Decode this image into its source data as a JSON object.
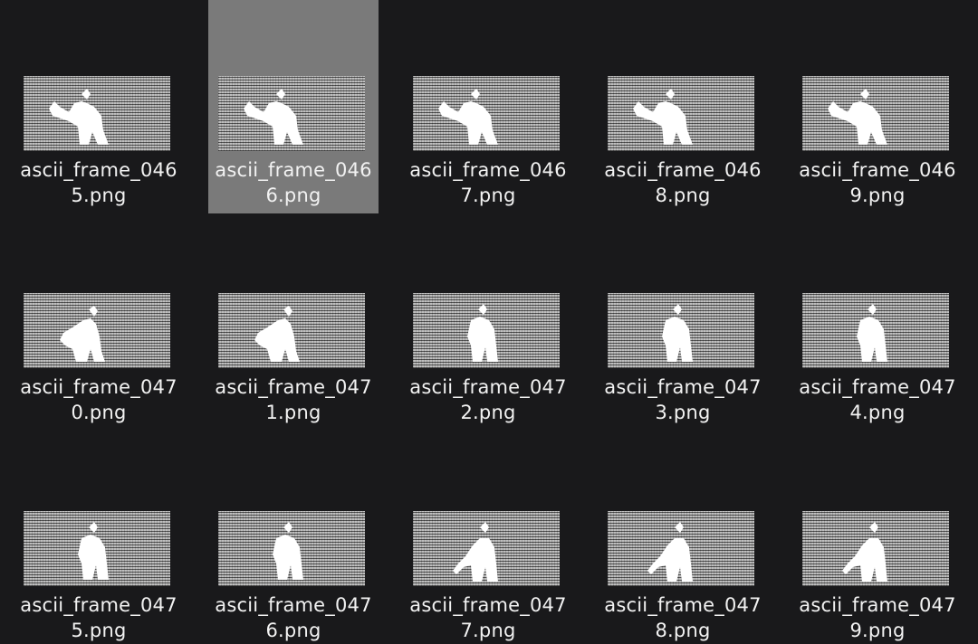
{
  "files": [
    {
      "line1": "ascii_frame_046",
      "line2": "5.png",
      "selected": false,
      "pose": "wave"
    },
    {
      "line1": "ascii_frame_046",
      "line2": "6.png",
      "selected": true,
      "pose": "wave"
    },
    {
      "line1": "ascii_frame_046",
      "line2": "7.png",
      "selected": false,
      "pose": "wave"
    },
    {
      "line1": "ascii_frame_046",
      "line2": "8.png",
      "selected": false,
      "pose": "wave"
    },
    {
      "line1": "ascii_frame_046",
      "line2": "9.png",
      "selected": false,
      "pose": "wave"
    },
    {
      "line1": "ascii_frame_047",
      "line2": "0.png",
      "selected": false,
      "pose": "turn"
    },
    {
      "line1": "ascii_frame_047",
      "line2": "1.png",
      "selected": false,
      "pose": "turn"
    },
    {
      "line1": "ascii_frame_047",
      "line2": "2.png",
      "selected": false,
      "pose": "stand"
    },
    {
      "line1": "ascii_frame_047",
      "line2": "3.png",
      "selected": false,
      "pose": "stand"
    },
    {
      "line1": "ascii_frame_047",
      "line2": "4.png",
      "selected": false,
      "pose": "stand"
    },
    {
      "line1": "ascii_frame_047",
      "line2": "5.png",
      "selected": false,
      "pose": "stand"
    },
    {
      "line1": "ascii_frame_047",
      "line2": "6.png",
      "selected": false,
      "pose": "stand"
    },
    {
      "line1": "ascii_frame_047",
      "line2": "7.png",
      "selected": false,
      "pose": "reach"
    },
    {
      "line1": "ascii_frame_047",
      "line2": "8.png",
      "selected": false,
      "pose": "reach"
    },
    {
      "line1": "ascii_frame_047",
      "line2": "9.png",
      "selected": false,
      "pose": "reach"
    }
  ],
  "colors": {
    "background": "#19191b",
    "selection": "#7a7a7a",
    "text": "#f2f2f2"
  }
}
